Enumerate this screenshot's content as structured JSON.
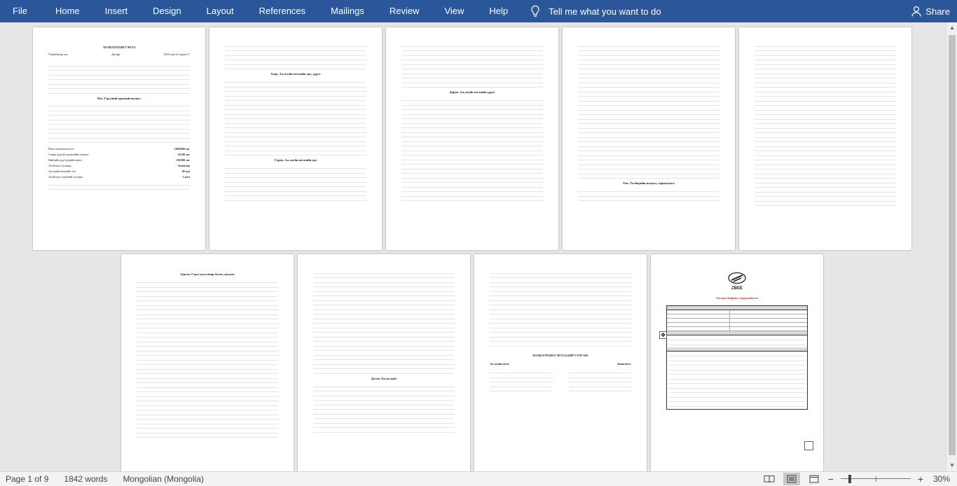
{
  "menu": {
    "tabs": [
      "File",
      "Home",
      "Insert",
      "Design",
      "Layout",
      "References",
      "Mailings",
      "Review",
      "View",
      "Help"
    ],
    "tell_me": "Tell me what you want to do",
    "share": "Share"
  },
  "document": {
    "title": "ХОЛБОЛТЫН ГЭРЭЭ",
    "place": "Улаанбаатар хот",
    "number": "Дугаар",
    "date": "2018 оны 12 сарын 17",
    "section1_heading": "Нэг. Гэрээний ерөнхий нөхцөл",
    "section2_heading": "Хоёр. Аж ахуйн нэгжийн эрх, үүрэг",
    "section3_heading": "Гурав. Аж ахуйн нэгжийн эрх",
    "section4_heading": "Дөрөв. Аж ахуйн нэгжийн үүрэг",
    "section5_heading": "Тав. Төлбөрийн нөхцөл, хариуцлага",
    "section6_heading": "Зургаа. Гэрээ дуусгавар болох, цуцлах",
    "section7_heading": "Долоо. Бусад зүйл",
    "signature_heading": "ХОЛБОЛТЫН ГЭРЭЭ БАЙГУУЛСАН:",
    "signer_left": "Аж ахуйн нэгж:",
    "signer_right": "Захиалагч:",
    "logo_text": "ZBEE",
    "form_title": "Ажлын байрны тодорхойлолт",
    "spec": [
      {
        "label": "Нэгж төлөвлөсөн тоо:",
        "value": "1,000,000 төг"
      },
      {
        "label": "Сарын үндсэн цалингийн хэмжээ:",
        "value": "311,00 төг"
      },
      {
        "label": "Нийтийн дэд бүтцийн өртөг:",
        "value": "110,000 төг"
      },
      {
        "label": "Холбогдох хугацаа:",
        "value": "Хоногоор"
      },
      {
        "label": "Аж ахуйн нэгжийн тоо:",
        "value": "40 хүн"
      },
      {
        "label": "Холбогдох гэрээний хугацаа:",
        "value": "1 жил"
      }
    ]
  },
  "status": {
    "page": "Page 1 of 9",
    "words": "1842 words",
    "language": "Mongolian (Mongolia)",
    "zoom": "30%",
    "zoom_fraction": 0.3
  }
}
